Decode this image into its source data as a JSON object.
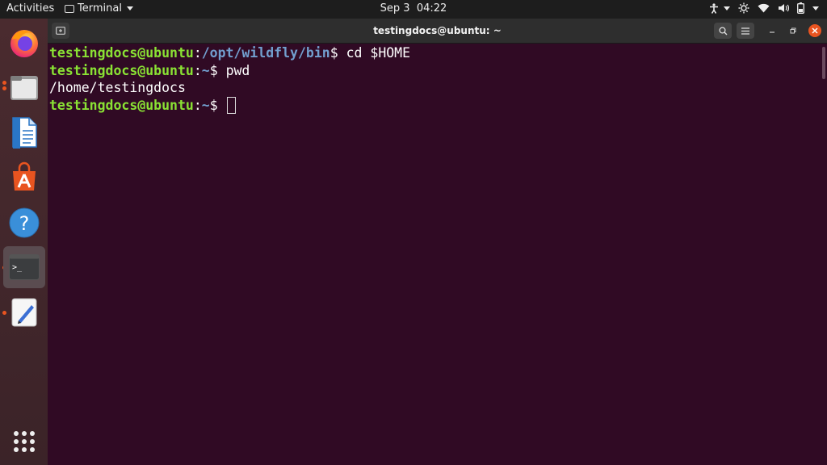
{
  "topbar": {
    "activities": "Activities",
    "app_menu": "Terminal",
    "date": "Sep 3",
    "time": "04:22"
  },
  "dock": {
    "items": [
      {
        "name": "firefox"
      },
      {
        "name": "files"
      },
      {
        "name": "libreoffice-writer"
      },
      {
        "name": "ubuntu-software"
      },
      {
        "name": "help"
      },
      {
        "name": "terminal"
      },
      {
        "name": "text-editor"
      },
      {
        "name": "show-applications"
      }
    ]
  },
  "window": {
    "title": "testingdocs@ubuntu: ~"
  },
  "terminal": {
    "lines": [
      {
        "user": "testingdocs@ubuntu",
        "sep": ":",
        "path": "/opt/wildfly/bin",
        "prompt": "$ ",
        "cmd": "cd $HOME"
      },
      {
        "user": "testingdocs@ubuntu",
        "sep": ":",
        "path": "~",
        "prompt": "$ ",
        "cmd": "pwd"
      },
      {
        "output": "/home/testingdocs"
      },
      {
        "user": "testingdocs@ubuntu",
        "sep": ":",
        "path": "~",
        "prompt": "$ ",
        "cmd": ""
      }
    ]
  },
  "colors": {
    "terminal_bg": "#300a24",
    "user": "#8ae234",
    "path": "#729fcf",
    "accent": "#e95420"
  }
}
